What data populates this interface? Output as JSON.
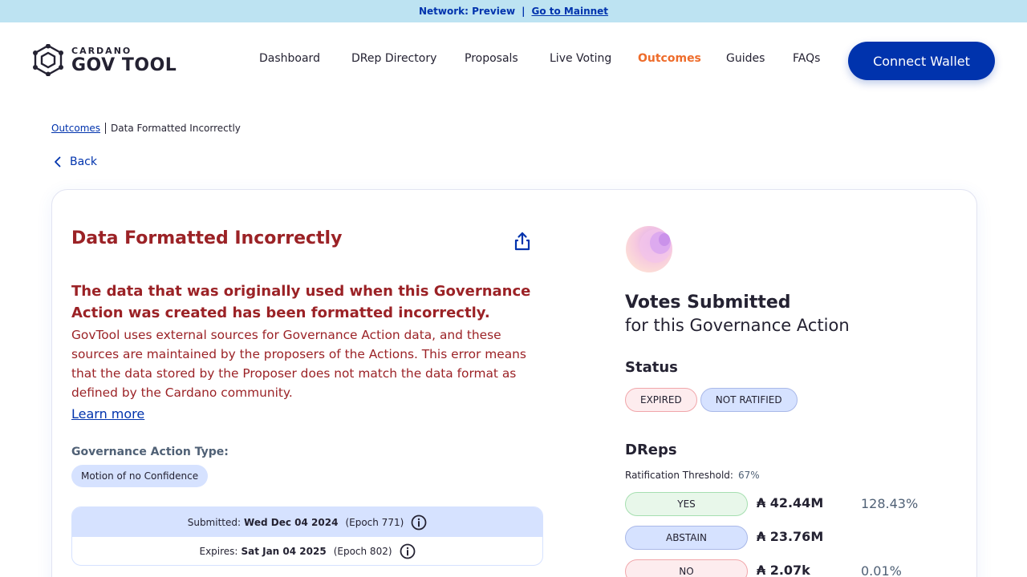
{
  "network_bar": {
    "network_label": "Network: Preview",
    "separator": "|",
    "mainnet_link": "Go to Mainnet"
  },
  "header": {
    "logo_small": "CARDANO",
    "logo_big": "GOV TOOL",
    "nav": [
      {
        "label": "Dashboard",
        "active": false
      },
      {
        "label": "DRep Directory",
        "active": false
      },
      {
        "label": "Proposals",
        "active": false
      },
      {
        "label": "Live Voting",
        "active": false
      },
      {
        "label": "Outcomes",
        "active": true
      },
      {
        "label": "Guides",
        "active": false
      },
      {
        "label": "FAQs",
        "active": false
      }
    ],
    "connect_wallet": "Connect Wallet"
  },
  "breadcrumb": {
    "parent": "Outcomes",
    "current": "Data Formatted Incorrectly"
  },
  "back_label": "Back",
  "proposal": {
    "title": "Data Formatted Incorrectly",
    "error_heading": "The data that was originally used when this Governance Action was created has been formatted incorrectly.",
    "error_body": "GovTool uses external sources for Governance Action data, and these sources are maintained by the proposers of the Actions. This error means that the data stored by the Proposer does not match the data format as defined by the Cardano community.",
    "learn_more": "Learn more",
    "type_label": "Governance Action Type:",
    "type_value": "Motion of no Confidence",
    "submitted": {
      "label": "Submitted:",
      "date": "Wed Dec 04 2024",
      "epoch": "(Epoch 771)"
    },
    "expires": {
      "label": "Expires:",
      "date": "Sat Jan 04 2025",
      "epoch": "(Epoch 802)"
    }
  },
  "votes": {
    "title": "Votes Submitted",
    "subtitle": "for this Governance Action",
    "status_label": "Status",
    "status_pills": [
      "EXPIRED",
      "NOT RATIFIED"
    ],
    "dreps_label": "DReps",
    "threshold_label": "Ratification Threshold:",
    "threshold_value": "67%",
    "rows": [
      {
        "label": "YES",
        "amount": "₳ 42.44M",
        "percent": "128.43%"
      },
      {
        "label": "ABSTAIN",
        "amount": "₳ 23.76M",
        "percent": ""
      },
      {
        "label": "NO",
        "amount": "₳ 2.07k",
        "percent": "0.01%"
      }
    ]
  },
  "colors": {
    "brand_blue": "#0033ad",
    "active_nav": "#ee6c2b",
    "error_red": "#9b2226",
    "network_bar_bg": "#bde3f2"
  },
  "icons": [
    "cardano-logo-icon",
    "share-icon",
    "chevron-left-icon",
    "info-icon",
    "votes-illustration"
  ]
}
